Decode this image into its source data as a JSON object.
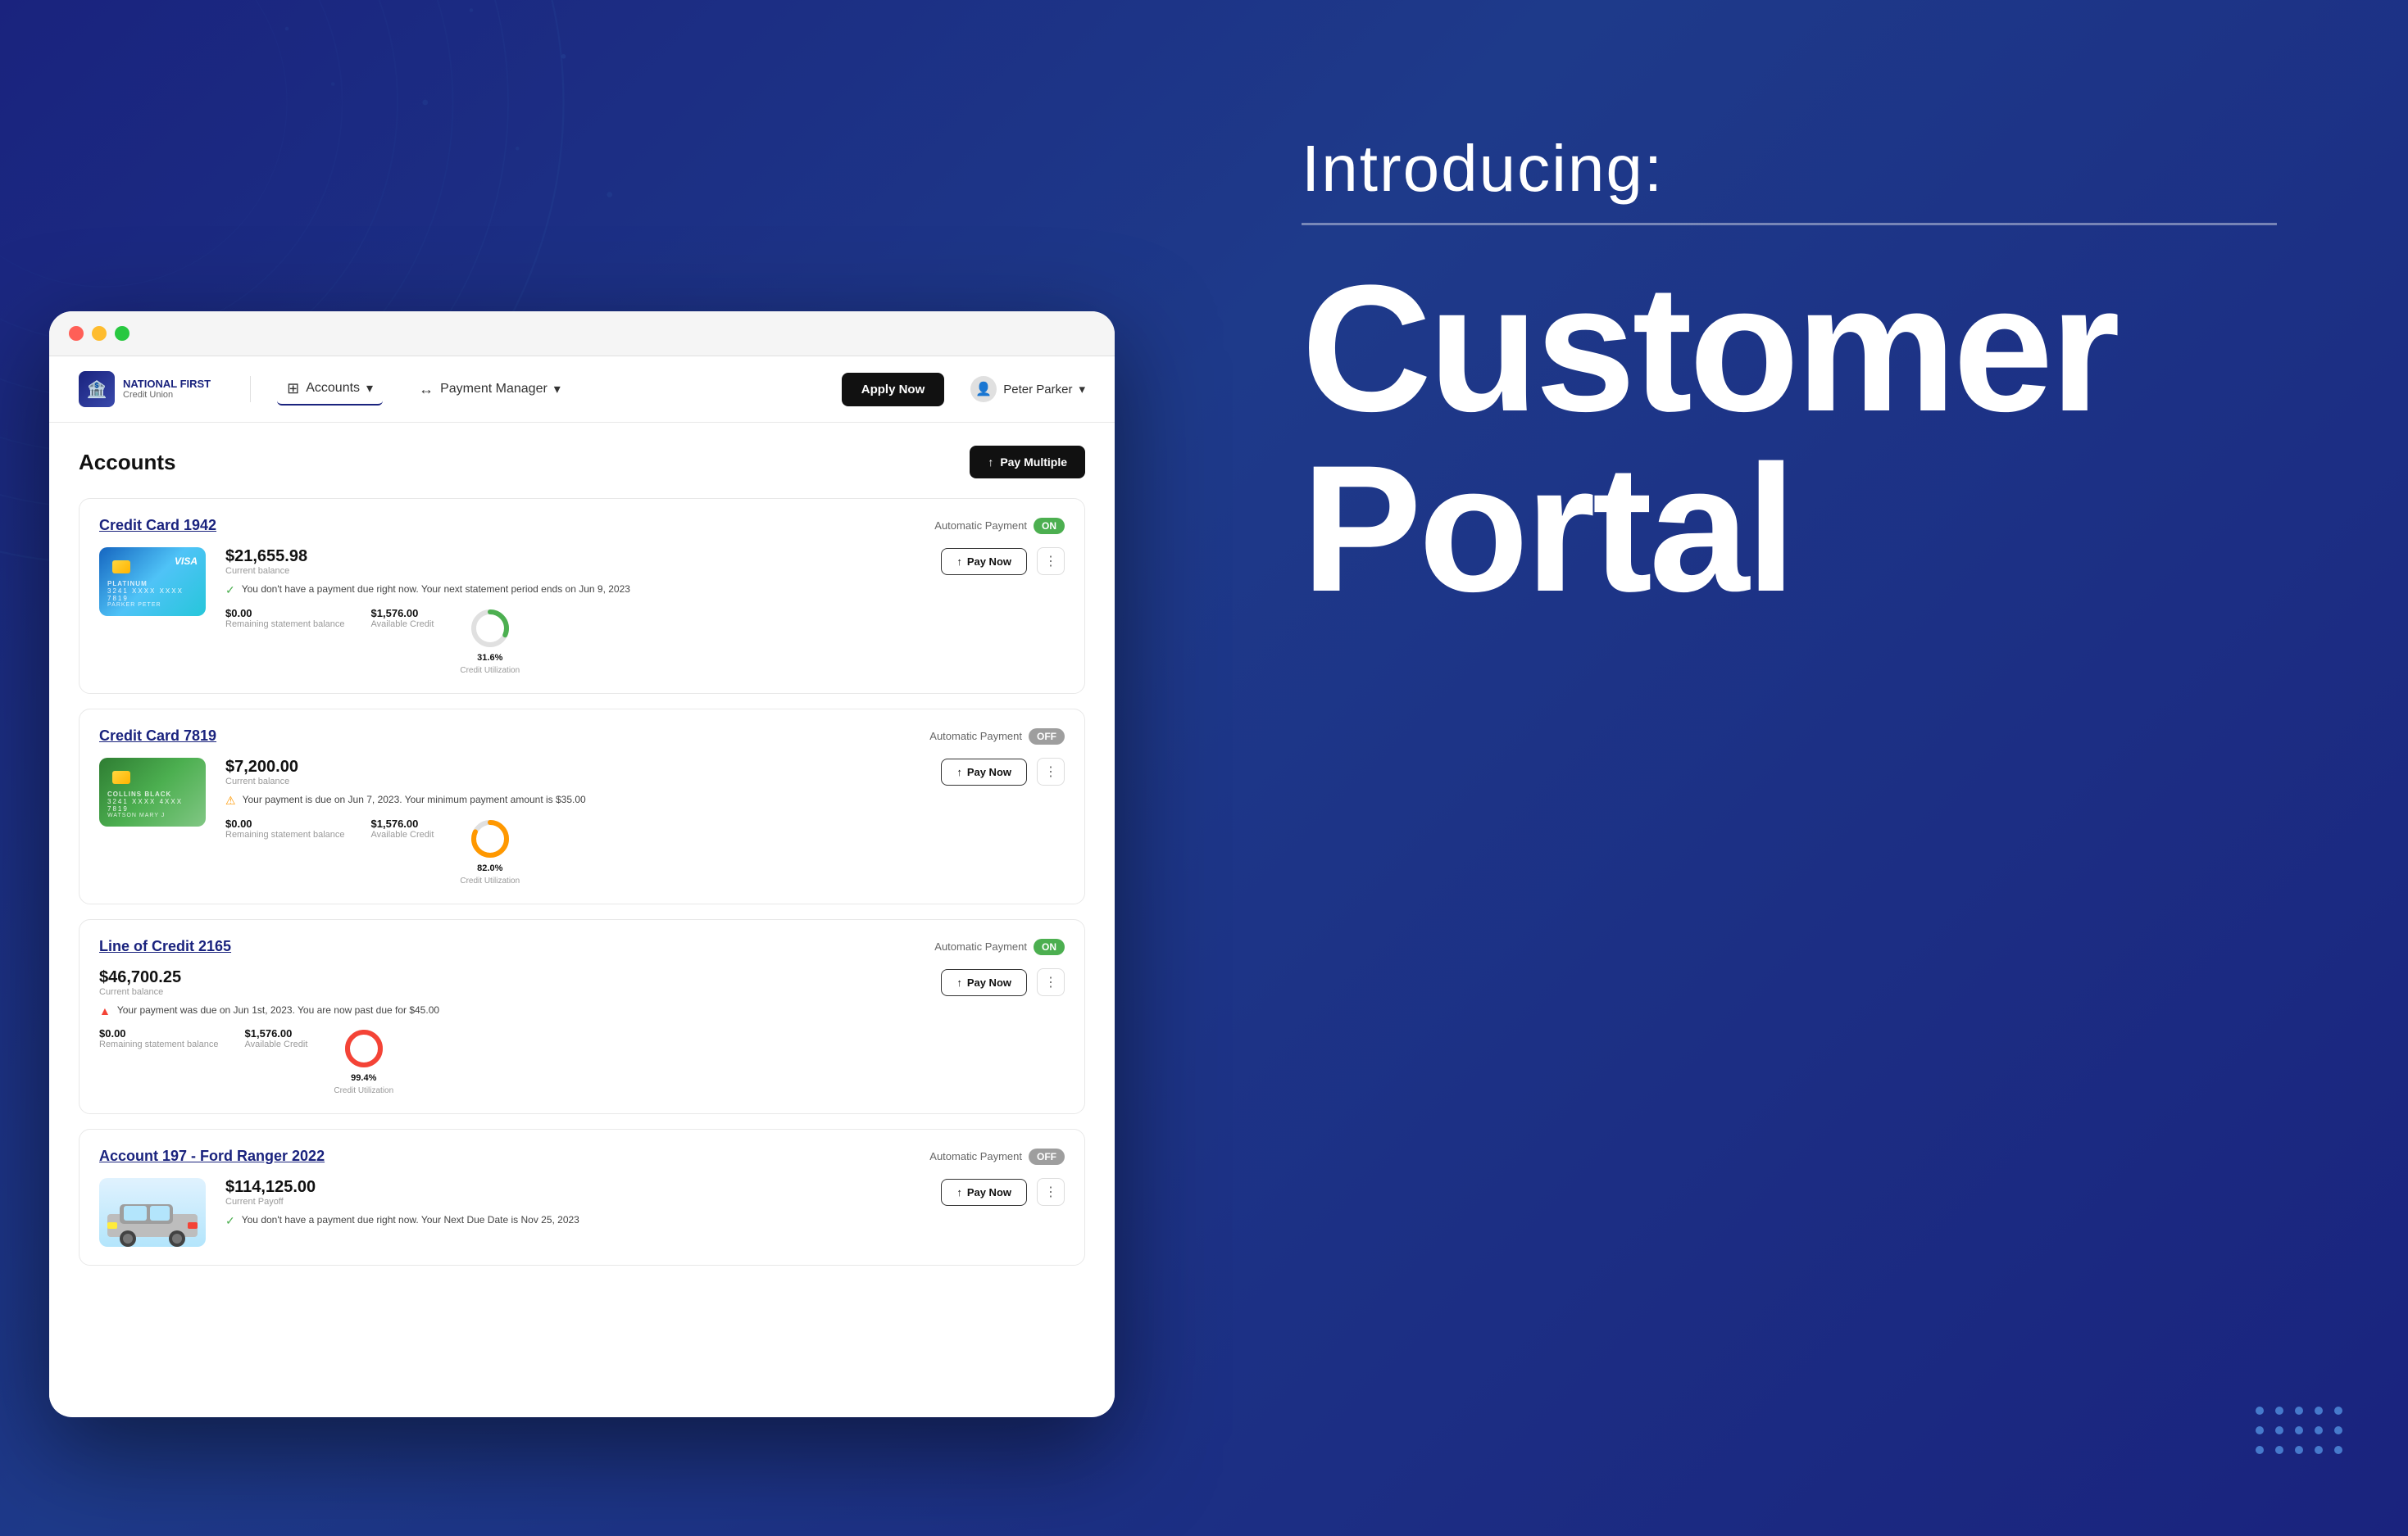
{
  "page": {
    "background_color": "#1a237e",
    "intro": {
      "label": "Introducing:",
      "title_line1": "Customer",
      "title_line2": "Portal"
    }
  },
  "browser": {
    "dots": [
      "red",
      "yellow",
      "green"
    ]
  },
  "nav": {
    "logo_line1": "NATIONAL FIRST",
    "logo_line2": "Credit Union",
    "accounts_label": "Accounts",
    "payment_manager_label": "Payment Manager",
    "apply_btn": "Apply Now",
    "user_name": "Peter Parker",
    "user_chevron": "▾"
  },
  "main": {
    "title": "Accounts",
    "pay_multiple_btn": "Pay Multiple",
    "accounts": [
      {
        "title": "Credit Card 1942",
        "auto_payment": "Automatic Payment",
        "auto_status": "ON",
        "balance": "$21,655.98",
        "balance_label": "Current balance",
        "card_type": "visa",
        "card_label": "Platinum",
        "card_number": "3241  XXXX  XXXX  7819",
        "card_name": "PARKER PETER",
        "status_type": "good",
        "status_text": "You don't have a payment due right now. Your next statement period ends on Jun 9, 2023",
        "remaining_balance": "$0.00",
        "remaining_label": "Remaining statement balance",
        "available_credit": "$1,576.00",
        "available_label": "Available Credit",
        "utilization": "31.6%",
        "utilization_label": "Credit Utilization",
        "utilization_value": 31.6,
        "donut_color": "#4caf50"
      },
      {
        "title": "Credit Card 7819",
        "auto_payment": "Automatic Payment",
        "auto_status": "OFF",
        "balance": "$7,200.00",
        "balance_label": "Current balance",
        "card_type": "green",
        "card_label": "Collins Black",
        "card_number": "3241  XXXX  4XXX  7819",
        "card_name": "WATSON MARY J",
        "status_type": "warning",
        "status_text": "Your payment is due on Jun 7, 2023. Your minimum payment amount is $35.00",
        "remaining_balance": "$0.00",
        "remaining_label": "Remaining statement balance",
        "available_credit": "$1,576.00",
        "available_label": "Available Credit",
        "utilization": "82.0%",
        "utilization_label": "Credit Utilization",
        "utilization_value": 82.0,
        "donut_color": "#ff9800"
      },
      {
        "title": "Line of Credit 2165",
        "auto_payment": "Automatic Payment",
        "auto_status": "ON",
        "balance": "$46,700.25",
        "balance_label": "Current balance",
        "card_type": "none",
        "status_type": "error",
        "status_text": "Your payment was due on Jun 1st, 2023. You are now past due for $45.00",
        "remaining_balance": "$0.00",
        "remaining_label": "Remaining statement balance",
        "available_credit": "$1,576.00",
        "available_label": "Available Credit",
        "utilization": "99.4%",
        "utilization_label": "Credit Utilization",
        "utilization_value": 99.4,
        "donut_color": "#f44336"
      },
      {
        "title": "Account 197 - Ford Ranger 2022",
        "auto_payment": "Automatic Payment",
        "auto_status": "OFF",
        "balance": "$114,125.00",
        "balance_label": "Current Payoff",
        "card_type": "car",
        "status_type": "good",
        "status_text": "You don't have a payment due right now. Your Next Due Date is Nov 25, 2023",
        "remaining_balance": "",
        "remaining_label": "",
        "available_credit": "",
        "available_label": "",
        "utilization": "",
        "utilization_label": "",
        "utilization_value": 0,
        "donut_color": "#4caf50"
      }
    ]
  }
}
